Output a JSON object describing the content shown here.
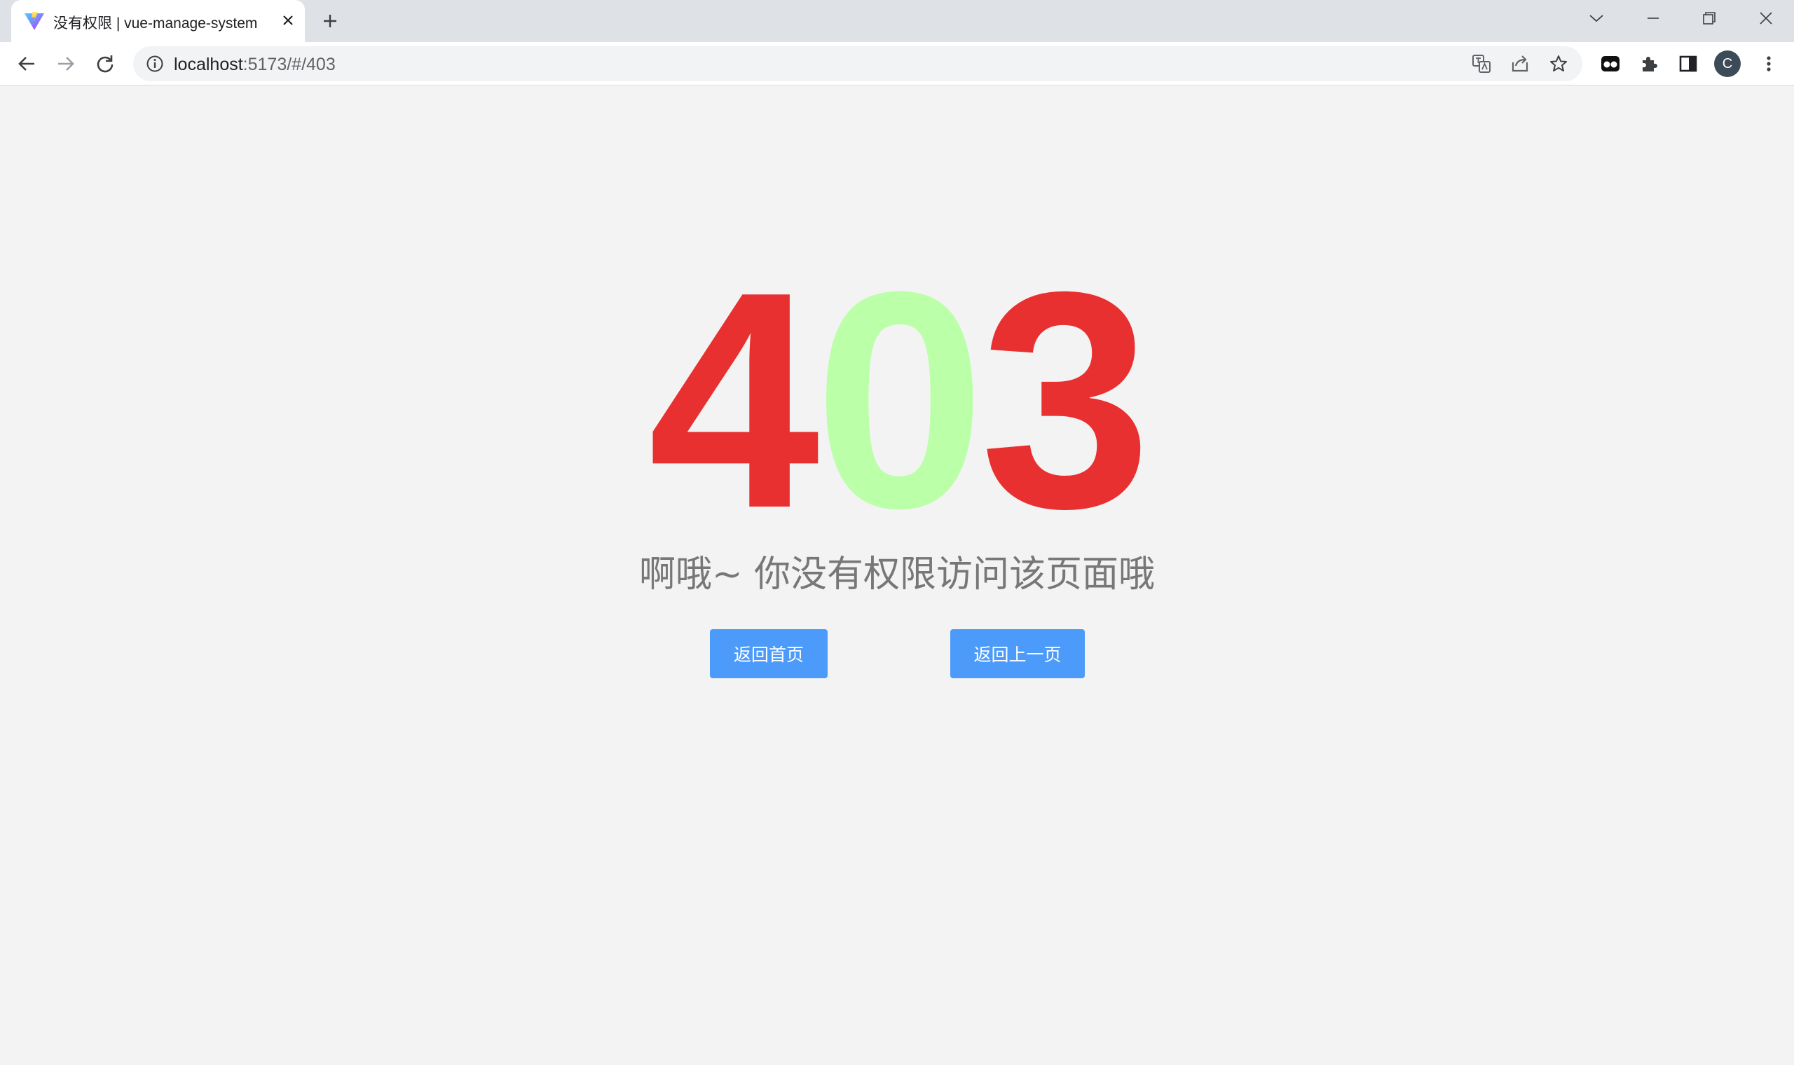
{
  "browser": {
    "tab": {
      "title": "没有权限 | vue-manage-system",
      "favicon": "vite-logo-icon"
    },
    "address_bar": {
      "host": "localhost",
      "path": ":5173/#/403"
    },
    "profile_initial": "C",
    "icons": {
      "tab_close": "close-icon",
      "new_tab": "plus-icon",
      "back": "back-arrow-icon",
      "forward": "forward-arrow-icon",
      "reload": "reload-icon",
      "site_info": "info-icon",
      "translate": "translate-icon",
      "share": "share-icon",
      "bookmark": "star-icon",
      "extension": "extension-icon",
      "puzzle": "puzzle-icon",
      "side_panel": "side-panel-icon",
      "menu": "kebab-menu-icon"
    }
  },
  "page": {
    "error_code": {
      "digit1": "4",
      "digit2": "0",
      "digit3": "3"
    },
    "message": "啊哦~ 你没有权限访问该页面哦",
    "buttons": {
      "home": "返回首页",
      "back": "返回上一页"
    }
  },
  "colors": {
    "code_red": "#e93030",
    "code_green": "#bbffa9",
    "button_blue": "#4c9bfa",
    "message_gray": "#777777",
    "page_background": "#f3f3f3"
  }
}
